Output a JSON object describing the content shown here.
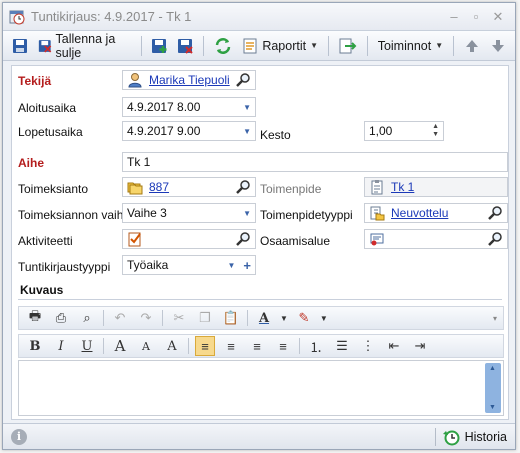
{
  "window": {
    "title": "Tuntikirjaus: 4.9.2017 - Tk 1"
  },
  "toolbar": {
    "save_close_label": "Tallenna ja sulje",
    "reports_label": "Raportit",
    "actions_label": "Toiminnot"
  },
  "form": {
    "tekija": {
      "label": "Tekijä",
      "value": "Marika Tiepuoli"
    },
    "aloitusaika": {
      "label": "Aloitusaika",
      "value": "4.9.2017 8.00"
    },
    "lopetusaika": {
      "label": "Lopetusaika",
      "value": "4.9.2017 9.00"
    },
    "kesto": {
      "label": "Kesto",
      "value": "1,00"
    },
    "aihe": {
      "label": "Aihe",
      "value": "Tk 1"
    },
    "toimeksianto": {
      "label": "Toimeksianto",
      "value": "887"
    },
    "toimenpide": {
      "label": "Toimenpide",
      "value": "Tk 1"
    },
    "toimeksiannon_vaihe": {
      "label": "Toimeksiannon vaihe",
      "value": "Vaihe 3"
    },
    "toimenpidetyyppi": {
      "label": "Toimenpidetyyppi",
      "value": "Neuvottelu"
    },
    "aktiviteetti": {
      "label": "Aktiviteetti",
      "value": ""
    },
    "osaamisalue": {
      "label": "Osaamisalue",
      "value": ""
    },
    "tuntikirjaustyyppi": {
      "label": "Tuntikirjaustyyppi",
      "value": "Työaika"
    }
  },
  "kuvaus": {
    "label": "Kuvaus",
    "text": ""
  },
  "statusbar": {
    "history_label": "Historia"
  }
}
